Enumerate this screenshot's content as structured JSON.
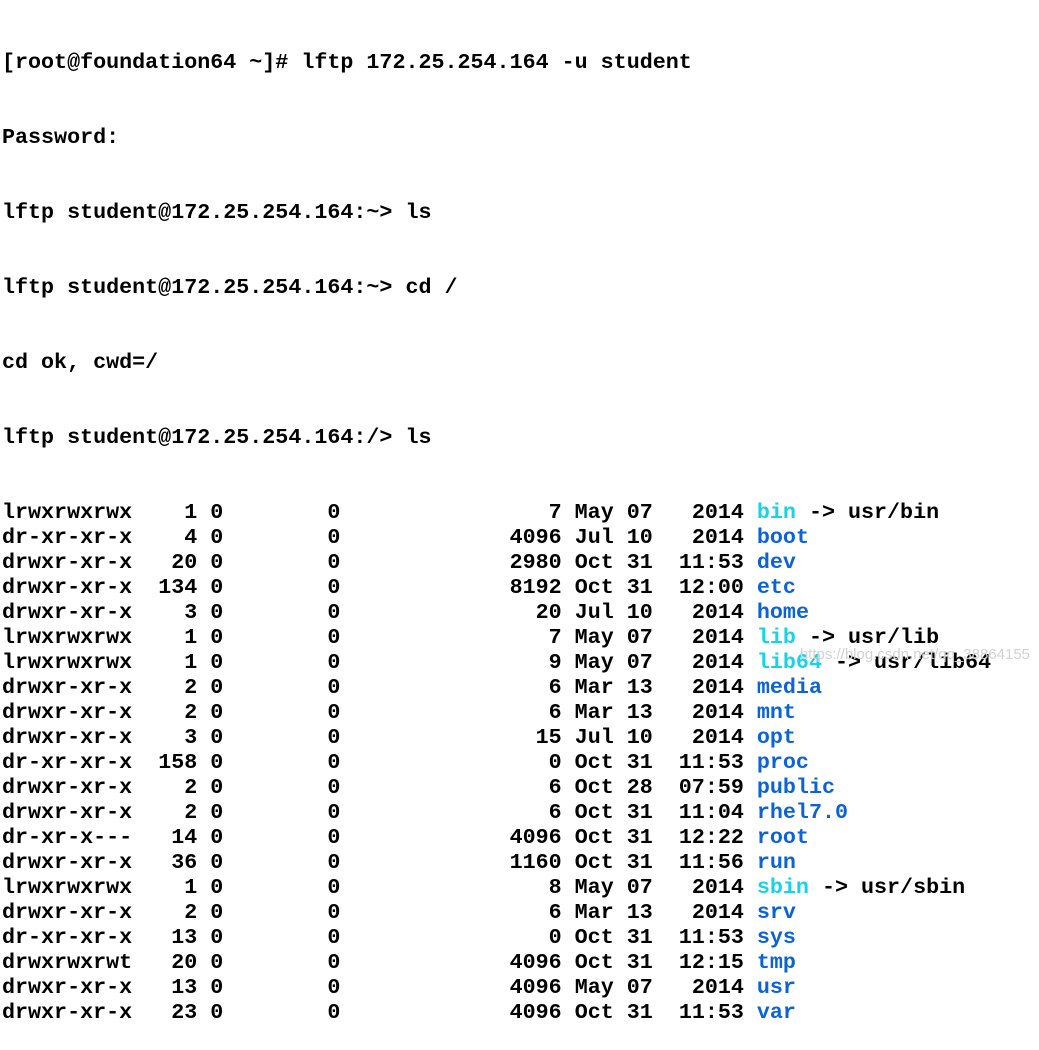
{
  "terminal": {
    "command_lines": [
      "[root@foundation64 ~]# lftp 172.25.254.164 -u student",
      "Password:",
      "lftp student@172.25.254.164:~> ls",
      "lftp student@172.25.254.164:~> cd /",
      "cd ok, cwd=/",
      "lftp student@172.25.254.164:/> ls"
    ],
    "entries": [
      {
        "perms": "lrwxrwxrwx",
        "links": "1",
        "owner": "0",
        "group": "0",
        "size": "7",
        "month": "May",
        "day": "07",
        "time": "2014",
        "name": "bin",
        "kind": "link",
        "target": "usr/bin"
      },
      {
        "perms": "dr-xr-xr-x",
        "links": "4",
        "owner": "0",
        "group": "0",
        "size": "4096",
        "month": "Jul",
        "day": "10",
        "time": "2014",
        "name": "boot",
        "kind": "dir",
        "target": ""
      },
      {
        "perms": "drwxr-xr-x",
        "links": "20",
        "owner": "0",
        "group": "0",
        "size": "2980",
        "month": "Oct",
        "day": "31",
        "time": "11:53",
        "name": "dev",
        "kind": "dir",
        "target": ""
      },
      {
        "perms": "drwxr-xr-x",
        "links": "134",
        "owner": "0",
        "group": "0",
        "size": "8192",
        "month": "Oct",
        "day": "31",
        "time": "12:00",
        "name": "etc",
        "kind": "dir",
        "target": ""
      },
      {
        "perms": "drwxr-xr-x",
        "links": "3",
        "owner": "0",
        "group": "0",
        "size": "20",
        "month": "Jul",
        "day": "10",
        "time": "2014",
        "name": "home",
        "kind": "dir",
        "target": ""
      },
      {
        "perms": "lrwxrwxrwx",
        "links": "1",
        "owner": "0",
        "group": "0",
        "size": "7",
        "month": "May",
        "day": "07",
        "time": "2014",
        "name": "lib",
        "kind": "link",
        "target": "usr/lib"
      },
      {
        "perms": "lrwxrwxrwx",
        "links": "1",
        "owner": "0",
        "group": "0",
        "size": "9",
        "month": "May",
        "day": "07",
        "time": "2014",
        "name": "lib64",
        "kind": "link",
        "target": "usr/lib64"
      },
      {
        "perms": "drwxr-xr-x",
        "links": "2",
        "owner": "0",
        "group": "0",
        "size": "6",
        "month": "Mar",
        "day": "13",
        "time": "2014",
        "name": "media",
        "kind": "dir",
        "target": ""
      },
      {
        "perms": "drwxr-xr-x",
        "links": "2",
        "owner": "0",
        "group": "0",
        "size": "6",
        "month": "Mar",
        "day": "13",
        "time": "2014",
        "name": "mnt",
        "kind": "dir",
        "target": ""
      },
      {
        "perms": "drwxr-xr-x",
        "links": "3",
        "owner": "0",
        "group": "0",
        "size": "15",
        "month": "Jul",
        "day": "10",
        "time": "2014",
        "name": "opt",
        "kind": "dir",
        "target": ""
      },
      {
        "perms": "dr-xr-xr-x",
        "links": "158",
        "owner": "0",
        "group": "0",
        "size": "0",
        "month": "Oct",
        "day": "31",
        "time": "11:53",
        "name": "proc",
        "kind": "dir",
        "target": ""
      },
      {
        "perms": "drwxr-xr-x",
        "links": "2",
        "owner": "0",
        "group": "0",
        "size": "6",
        "month": "Oct",
        "day": "28",
        "time": "07:59",
        "name": "public",
        "kind": "dir",
        "target": ""
      },
      {
        "perms": "drwxr-xr-x",
        "links": "2",
        "owner": "0",
        "group": "0",
        "size": "6",
        "month": "Oct",
        "day": "31",
        "time": "11:04",
        "name": "rhel7.0",
        "kind": "dir",
        "target": ""
      },
      {
        "perms": "dr-xr-x---",
        "links": "14",
        "owner": "0",
        "group": "0",
        "size": "4096",
        "month": "Oct",
        "day": "31",
        "time": "12:22",
        "name": "root",
        "kind": "dir",
        "target": ""
      },
      {
        "perms": "drwxr-xr-x",
        "links": "36",
        "owner": "0",
        "group": "0",
        "size": "1160",
        "month": "Oct",
        "day": "31",
        "time": "11:56",
        "name": "run",
        "kind": "dir",
        "target": ""
      },
      {
        "perms": "lrwxrwxrwx",
        "links": "1",
        "owner": "0",
        "group": "0",
        "size": "8",
        "month": "May",
        "day": "07",
        "time": "2014",
        "name": "sbin",
        "kind": "link",
        "target": "usr/sbin"
      },
      {
        "perms": "drwxr-xr-x",
        "links": "2",
        "owner": "0",
        "group": "0",
        "size": "6",
        "month": "Mar",
        "day": "13",
        "time": "2014",
        "name": "srv",
        "kind": "dir",
        "target": ""
      },
      {
        "perms": "dr-xr-xr-x",
        "links": "13",
        "owner": "0",
        "group": "0",
        "size": "0",
        "month": "Oct",
        "day": "31",
        "time": "11:53",
        "name": "sys",
        "kind": "dir",
        "target": ""
      },
      {
        "perms": "drwxrwxrwt",
        "links": "20",
        "owner": "0",
        "group": "0",
        "size": "4096",
        "month": "Oct",
        "day": "31",
        "time": "12:15",
        "name": "tmp",
        "kind": "dir",
        "target": ""
      },
      {
        "perms": "drwxr-xr-x",
        "links": "13",
        "owner": "0",
        "group": "0",
        "size": "4096",
        "month": "May",
        "day": "07",
        "time": "2014",
        "name": "usr",
        "kind": "dir",
        "target": ""
      },
      {
        "perms": "drwxr-xr-x",
        "links": "23",
        "owner": "0",
        "group": "0",
        "size": "4096",
        "month": "Oct",
        "day": "31",
        "time": "11:53",
        "name": "var",
        "kind": "dir",
        "target": ""
      }
    ],
    "link_arrow": " -> "
  },
  "watermark": "https://blog.csdn.net/qq_38864155",
  "colors": {
    "background": "#ffffff",
    "text": "#000000",
    "directory": "#0a63d8",
    "symlink": "#17d2e8"
  }
}
